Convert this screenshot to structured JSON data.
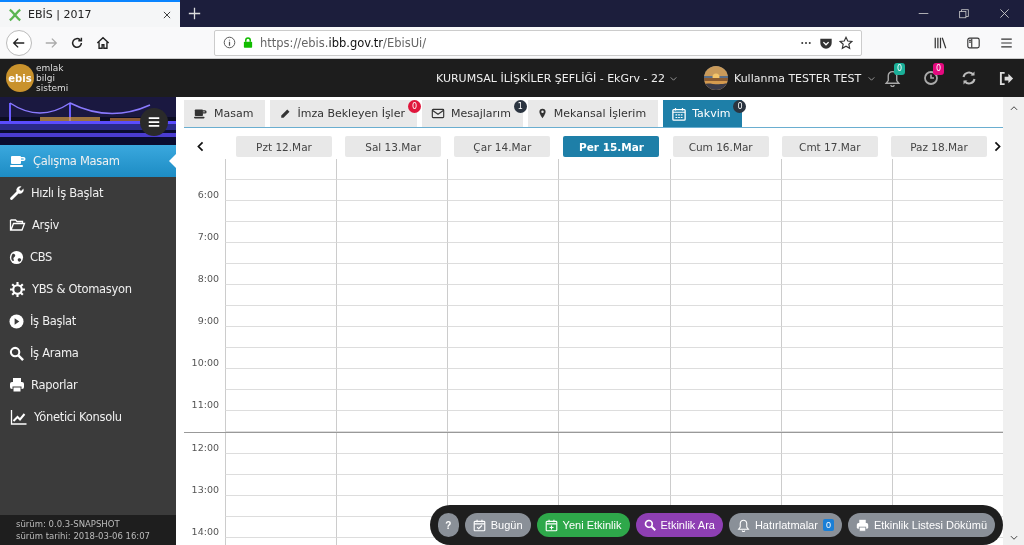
{
  "browser": {
    "tab_title": "EBİS | 2017",
    "url": "https://ebis.**ibb.gov.tr**/EbisUi/"
  },
  "header": {
    "logo_mark": "ebis",
    "logo_lines": [
      "emlak",
      "bilgi",
      "sistemi"
    ],
    "unit": "KURUMSAL İLİŞKİLER ŞEFLİĞİ - EkGrv - 22",
    "user": "Kullanma TESTER TEST",
    "indicators": [
      {
        "count": "0",
        "color": "#1aaf98"
      },
      {
        "count": "0",
        "color": "#e5097f"
      }
    ]
  },
  "sidebar": {
    "items": [
      {
        "label": "Çalışma Masam",
        "selected": true
      },
      {
        "label": "Hızlı İş Başlat",
        "selected": false
      },
      {
        "label": "Arşiv",
        "selected": false
      },
      {
        "label": "CBS",
        "selected": false
      },
      {
        "label": "YBS & Otomasyon",
        "selected": false
      },
      {
        "label": "İş Başlat",
        "selected": false
      },
      {
        "label": "İş Arama",
        "selected": false
      },
      {
        "label": "Raporlar",
        "selected": false
      },
      {
        "label": "Yönetici Konsolu",
        "selected": false
      }
    ],
    "version_lines": [
      "sürüm: 0.0.3-SNAPSHOT",
      "sürüm tarihi: 2018-03-06 16:07"
    ]
  },
  "tabs": [
    {
      "label": "Masam",
      "selected": false
    },
    {
      "label": "İmza Bekleyen İşler",
      "badge": {
        "count": "0",
        "color": "#e0163c"
      },
      "selected": false
    },
    {
      "label": "Mesajlarım",
      "badge": {
        "count": "1",
        "color": "#2b3440"
      },
      "selected": false
    },
    {
      "label": "Mekansal İşlerim",
      "selected": false
    },
    {
      "label": "Takvim",
      "badge": {
        "count": "0",
        "color": "#2b3440"
      },
      "selected": true
    }
  ],
  "calendar": {
    "days": [
      {
        "label": "Pzt 12.Mar",
        "selected": false
      },
      {
        "label": "Sal 13.Mar",
        "selected": false
      },
      {
        "label": "Çar 14.Mar",
        "selected": false
      },
      {
        "label": "Per 15.Mar",
        "selected": true
      },
      {
        "label": "Cum 16.Mar",
        "selected": false
      },
      {
        "label": "Cmt 17.Mar",
        "selected": false
      },
      {
        "label": "Paz 18.Mar",
        "selected": false
      }
    ],
    "times": [
      "6:00",
      "7:00",
      "8:00",
      "9:00",
      "10:00",
      "11:00",
      "12:00",
      "13:00",
      "14:00"
    ]
  },
  "toolbar": {
    "buttons": [
      {
        "label": "?",
        "kind": "help",
        "color": "#8a9098"
      },
      {
        "label": "Bugün",
        "kind": "today",
        "color": "#8a9098"
      },
      {
        "label": "Yeni Etkinlik",
        "kind": "new",
        "color": "#2ea84a"
      },
      {
        "label": "Etkinlik Ara",
        "kind": "search",
        "color": "#8e3fb3"
      },
      {
        "label": "Hatırlatmalar",
        "kind": "reminders",
        "color": "#8a9098",
        "badge": "0"
      },
      {
        "label": "Etkinlik Listesi Dökümü",
        "kind": "print",
        "color": "#8a9098"
      }
    ]
  }
}
